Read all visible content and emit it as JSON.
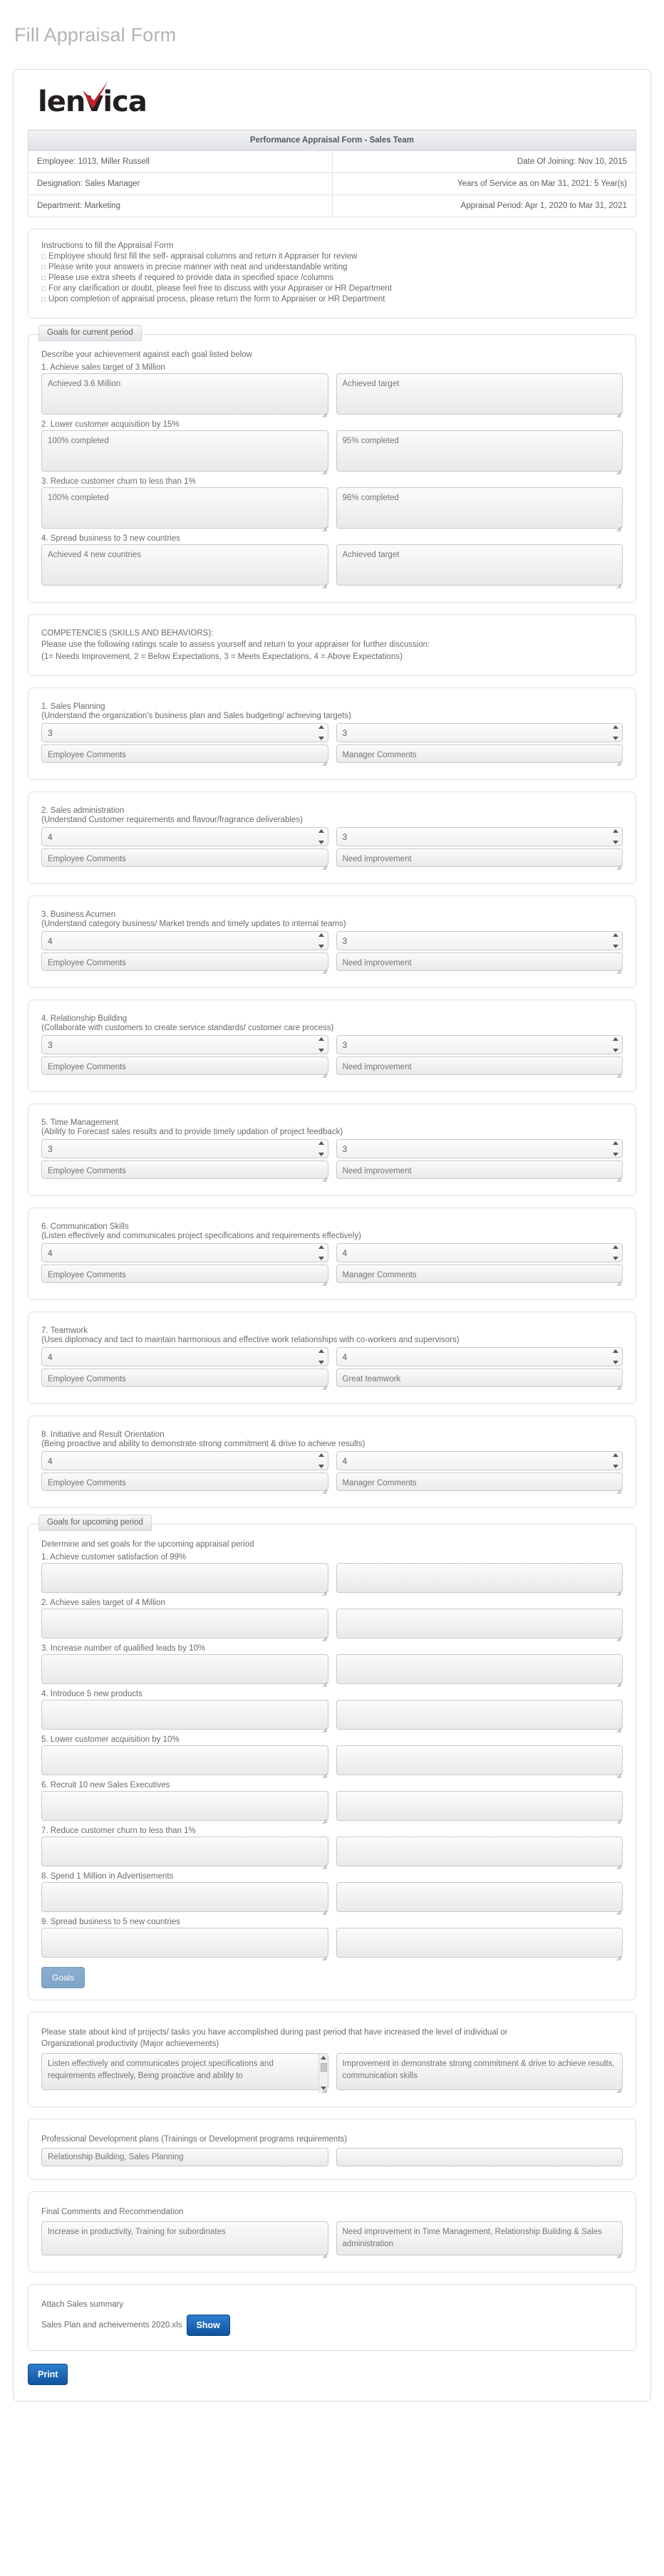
{
  "page": {
    "title": "Fill Appraisal Form",
    "logo_text": "lenvica",
    "logo_accent_color": "#c8202a"
  },
  "header_table": {
    "caption": "Performance Appraisal Form - Sales Team",
    "rows": [
      {
        "left": "Employee: 1013, Miller Russell",
        "right": "Date Of Joining: Nov 10, 2015"
      },
      {
        "left": "Designation: Sales Manager",
        "right": "Years of Service as on Mar 31, 2021: 5 Year(s)"
      },
      {
        "left": "Department: Marketing",
        "right": "Appraisal Period: Apr 1, 2020 to Mar 31, 2021"
      }
    ]
  },
  "instructions": {
    "heading": "Instructions to fill the Appraisal Form",
    "items": [
      "Employee should first fill the self- appraisal columns and return it Appraiser for review",
      "Please write your answers in precise manner with neat and understandable writing",
      "Please use extra sheets if required to provide data in specified space /columns",
      "For any clarification or doubt, please feel free to discuss with your Appraiser or HR Department",
      "Upon completion of appraisal process, please return the form to Appraiser or HR Department"
    ]
  },
  "current_goals": {
    "legend": "Goals for current period",
    "intro": "Describe your achievement against each goal listed below",
    "items": [
      {
        "label": "1. Achieve sales target of 3 Million",
        "employee_placeholder": "Achieved 3.6 Million",
        "manager_placeholder": "Achieved target"
      },
      {
        "label": "2. Lower customer acquisition by 15%",
        "employee_placeholder": "100% completed",
        "manager_placeholder": "95% completed"
      },
      {
        "label": "3. Reduce customer churn to less than 1%",
        "employee_placeholder": "100% completed",
        "manager_placeholder": "96% completed"
      },
      {
        "label": "4. Spread business to 3 new countries",
        "employee_placeholder": "Achieved 4 new countries",
        "manager_placeholder": "Achieved target"
      }
    ]
  },
  "competencies_intro": {
    "line1": "COMPETENCIES (SKILLS AND BEHAVIORS):",
    "line2": "Please use the following ratings scale to assess yourself and return to your appraiser for further discussion:",
    "line3": "(1= Needs Improvement, 2 = Below Expectations, 3 = Meets Expectations, 4 = Above Expectations)"
  },
  "competencies": [
    {
      "title": "1. Sales Planning",
      "description": "(Understand the organization's business plan and Sales budgeting/ achieving targets)",
      "employee_rating": "3",
      "manager_rating": "3",
      "employee_placeholder": "Employee Comments",
      "manager_placeholder": "Manager Comments"
    },
    {
      "title": "2. Sales administration",
      "description": "(Understand Customer requirements and flavour/fragrance deliverables)",
      "employee_rating": "4",
      "manager_rating": "3",
      "employee_placeholder": "Employee Comments",
      "manager_placeholder": "Need improvement"
    },
    {
      "title": "3. Business Acumen",
      "description": "(Understand category business/ Market trends and timely updates to internal teams)",
      "employee_rating": "4",
      "manager_rating": "3",
      "employee_placeholder": "Employee Comments",
      "manager_placeholder": "Need improvement"
    },
    {
      "title": "4. Relationship Building",
      "description": "(Collaborate with customers to create service standards/ customer care process)",
      "employee_rating": "3",
      "manager_rating": "3",
      "employee_placeholder": "Employee Comments",
      "manager_placeholder": "Need improvement"
    },
    {
      "title": "5. Time Management",
      "description": "(Ability to Forecast sales results and to provide timely updation of project feedback)",
      "employee_rating": "3",
      "manager_rating": "3",
      "employee_placeholder": "Employee Comments",
      "manager_placeholder": "Need improvement"
    },
    {
      "title": "6. Communication Skills",
      "description": "(Listen effectively and communicates project specifications and requirements effectively)",
      "employee_rating": "4",
      "manager_rating": "4",
      "employee_placeholder": "Employee Comments",
      "manager_placeholder": "Manager Comments"
    },
    {
      "title": "7. Teamwork",
      "description": "(Uses diplomacy and tact to maintain harmonious and effective work relationships with co-workers and supervisors)",
      "employee_rating": "4",
      "manager_rating": "4",
      "employee_placeholder": "Employee Comments",
      "manager_placeholder": "Great teamwork"
    },
    {
      "title": "8. Initiative and Result Orientation",
      "description": "(Being proactive and ability to demonstrate strong commitment & drive to achieve results)",
      "employee_rating": "4",
      "manager_rating": "4",
      "employee_placeholder": "Employee Comments",
      "manager_placeholder": "Manager Comments"
    }
  ],
  "upcoming_goals": {
    "legend": "Goals for upcoming period",
    "intro": "Determine and set goals for the upcoming appraisal period",
    "items": [
      {
        "label": "1. Achieve customer satisfaction of 99%"
      },
      {
        "label": "2. Achieve sales target of 4 Million"
      },
      {
        "label": "3. Increase number of qualified leads by 10%"
      },
      {
        "label": "4. Introduce 5 new products"
      },
      {
        "label": "5. Lower customer acquisition by 10%"
      },
      {
        "label": "6. Recruit 10 new Sales Executives"
      },
      {
        "label": "7. Reduce customer churn to less than 1%"
      },
      {
        "label": "8. Spend 1 Million in Advertisements"
      },
      {
        "label": "9. Spread business to 5 new countries"
      }
    ],
    "button_label": "Goals"
  },
  "achievements": {
    "prompt_line1": "Please state about kind of projects/ tasks you have accomplished during past period that have increased the level of individual or",
    "prompt_line2": "Organizational productivity (Major achievements)",
    "employee_placeholder": "Listen effectively and communicates project specifications and requirements effectively, Being proactive and ability to",
    "manager_placeholder": "Improvement in demonstrate strong commitment & drive to achieve results, communication skills"
  },
  "development": {
    "prompt": "Professional Development plans (Trainings or Development programs requirements)",
    "employee_placeholder": "Relationship Building, Sales Planning",
    "manager_placeholder": ""
  },
  "final_comments": {
    "prompt": "Final Comments and Recommendation",
    "employee_placeholder": "Increase in productivity, Training for subordinates",
    "manager_placeholder": "Need improvement in Time Management, Relationship Building & Sales administration"
  },
  "attachment": {
    "prompt": "Attach Sales summary",
    "file_name": "Sales Plan and acheivements 2020.xls",
    "show_button": "Show"
  },
  "footer": {
    "print_button": "Print"
  }
}
